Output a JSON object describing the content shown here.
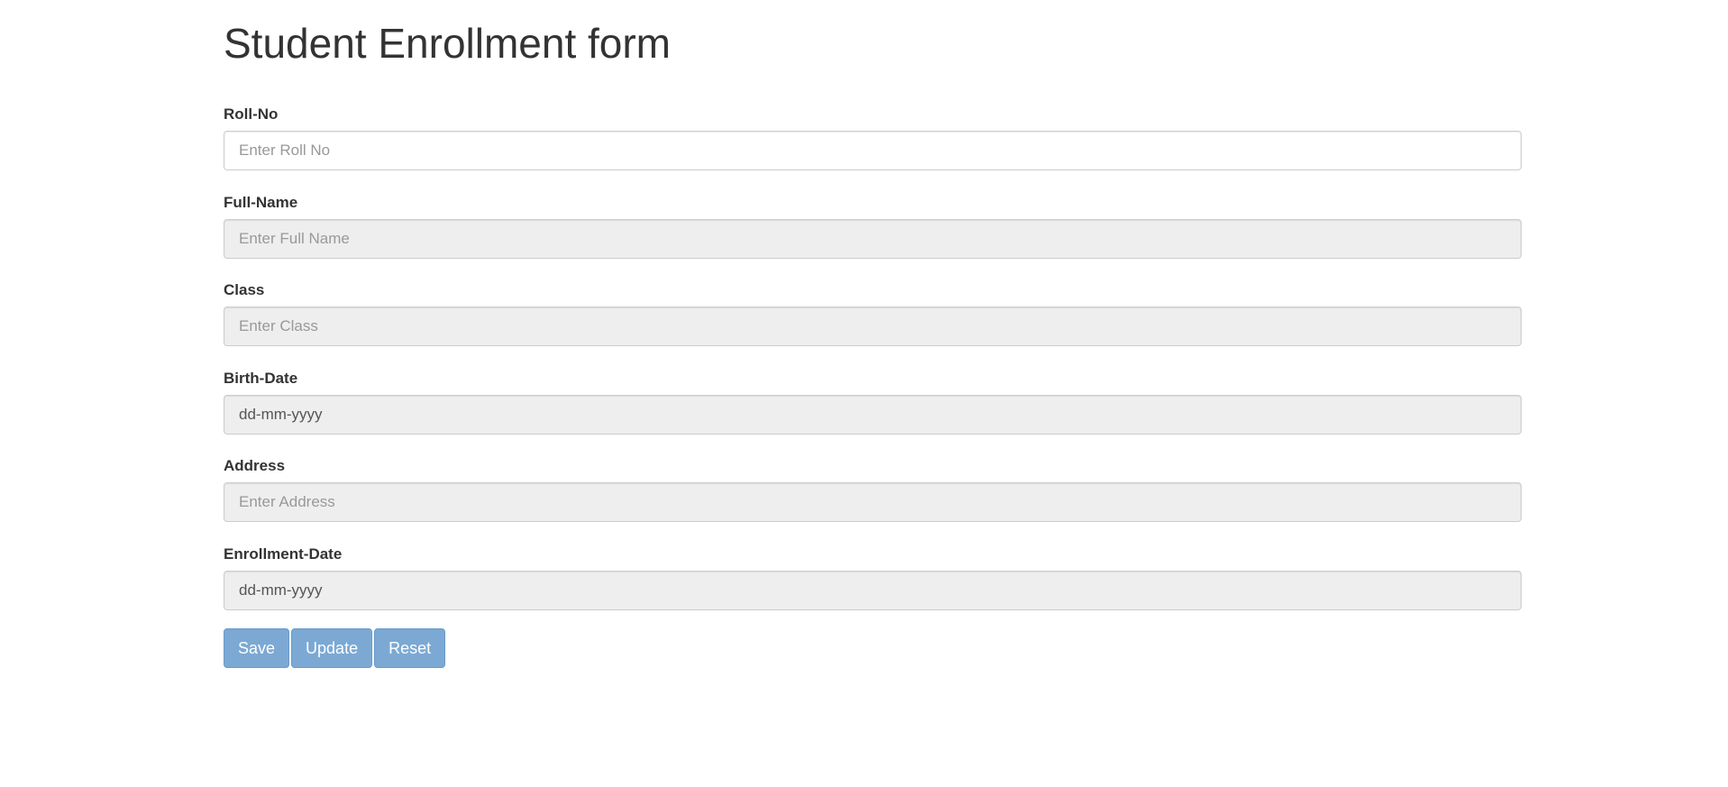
{
  "page": {
    "title": "Student Enrollment form"
  },
  "form": {
    "fields": [
      {
        "label": "Roll-No",
        "placeholder": "Enter Roll No",
        "value": "",
        "disabled": false
      },
      {
        "label": "Full-Name",
        "placeholder": "Enter Full Name",
        "value": "",
        "disabled": true
      },
      {
        "label": "Class",
        "placeholder": "Enter Class",
        "value": "",
        "disabled": true
      },
      {
        "label": "Birth-Date",
        "placeholder": "",
        "value": "dd-mm-yyyy",
        "disabled": true
      },
      {
        "label": "Address",
        "placeholder": "Enter Address",
        "value": "",
        "disabled": true
      },
      {
        "label": "Enrollment-Date",
        "placeholder": "",
        "value": "dd-mm-yyyy",
        "disabled": true
      }
    ]
  },
  "buttons": {
    "save_label": "Save",
    "update_label": "Update",
    "reset_label": "Reset"
  },
  "colors": {
    "button_bg": "#7ba9d4",
    "disabled_input_bg": "#eeeeee",
    "text": "#333333"
  }
}
